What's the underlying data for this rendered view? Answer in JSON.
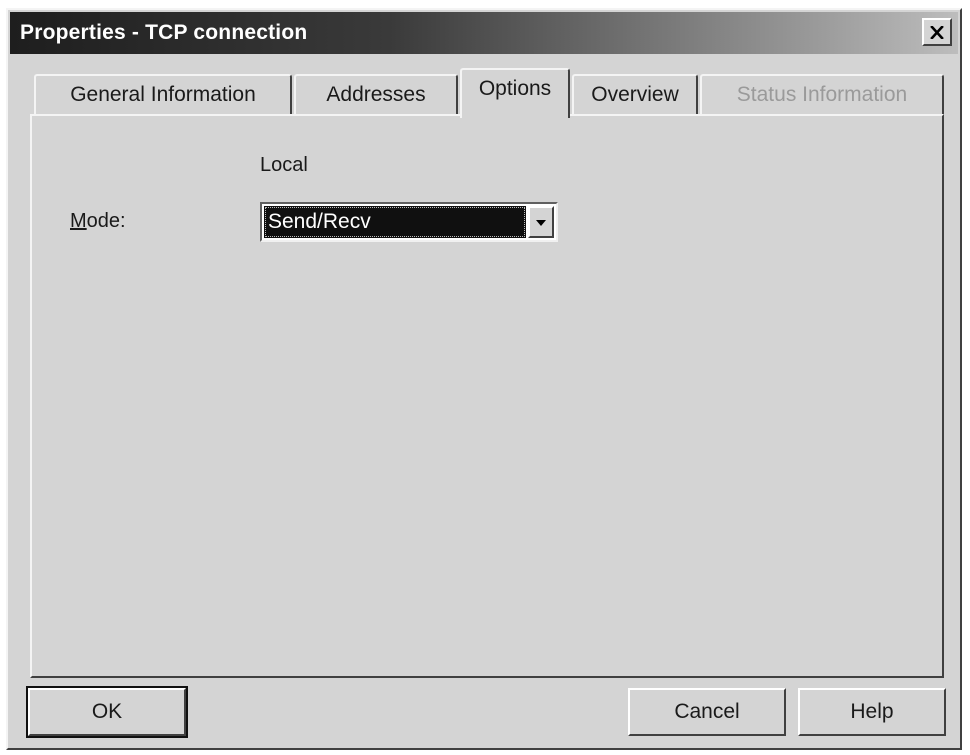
{
  "window": {
    "title": "Properties - TCP connection",
    "close_icon": "close-icon"
  },
  "tabs": [
    {
      "label": "General Information",
      "state": "normal"
    },
    {
      "label": "Addresses",
      "state": "normal"
    },
    {
      "label": "Options",
      "state": "active"
    },
    {
      "label": "Overview",
      "state": "normal"
    },
    {
      "label": "Status Information",
      "state": "disabled"
    }
  ],
  "options": {
    "column_header": "Local",
    "mode": {
      "label_mnemonic": "M",
      "label_rest": "ode:",
      "selected": "Send/Recv",
      "dropdown_icon": "chevron-down-icon"
    }
  },
  "buttons": {
    "ok": "OK",
    "cancel": "Cancel",
    "help": "Help"
  },
  "colors": {
    "face": "#d4d4d4",
    "selection": "#101010",
    "disabled_text": "#9a9a9a"
  }
}
